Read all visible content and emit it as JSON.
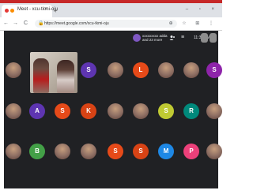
{
  "browser": {
    "tab_title": "Meet - xcu-tkmi-oju",
    "tab_close": "×",
    "new_tab": "+",
    "window_controls": "– ▫ ×",
    "url": "https://meet.google.com/xcu-tkmi-oju",
    "nav_back": "←",
    "nav_forward": "→",
    "nav_reload": "C",
    "lock": "🔒",
    "toolbar_icons": "⊕ ☆ ⊞ ⋮",
    "accent": "#c62828"
  },
  "meet": {
    "host_name": "xxxxxxxxx adda",
    "host_sub": "and 23 more",
    "people_icon": "people-icon",
    "menu_icon": "≡",
    "time": "11:39 AM",
    "more_icon": "⋮",
    "background": "#202124"
  },
  "tiles": [
    {
      "type": "photo",
      "letter": ""
    },
    {
      "type": "letter",
      "letter": "S",
      "color": "#5e35b1"
    },
    {
      "type": "photo",
      "letter": ""
    },
    {
      "type": "letter",
      "letter": "L",
      "color": "#e64a19"
    },
    {
      "type": "photo",
      "letter": ""
    },
    {
      "type": "photo",
      "letter": ""
    },
    {
      "type": "letter",
      "letter": "S",
      "color": "#8e24aa"
    },
    {
      "type": "photo",
      "letter": ""
    },
    {
      "type": "letter",
      "letter": "A",
      "color": "#5e35b1"
    },
    {
      "type": "letter",
      "letter": "S",
      "color": "#e64a19"
    },
    {
      "type": "letter",
      "letter": "K",
      "color": "#d84315"
    },
    {
      "type": "photo",
      "letter": ""
    },
    {
      "type": "photo",
      "letter": ""
    },
    {
      "type": "letter",
      "letter": "S",
      "color": "#c0ca33"
    },
    {
      "type": "letter",
      "letter": "R",
      "color": "#00897b"
    },
    {
      "type": "photo",
      "letter": ""
    },
    {
      "type": "photo",
      "letter": ""
    },
    {
      "type": "letter",
      "letter": "B",
      "color": "#43a047"
    },
    {
      "type": "photo",
      "letter": ""
    },
    {
      "type": "photo",
      "letter": ""
    },
    {
      "type": "letter",
      "letter": "S",
      "color": "#e64a19"
    },
    {
      "type": "letter",
      "letter": "S",
      "color": "#d84315"
    },
    {
      "type": "letter",
      "letter": "M",
      "color": "#1e88e5"
    },
    {
      "type": "letter",
      "letter": "P",
      "color": "#ec407a"
    },
    {
      "type": "photo",
      "letter": ""
    },
    {
      "type": "photo",
      "letter": ""
    }
  ]
}
